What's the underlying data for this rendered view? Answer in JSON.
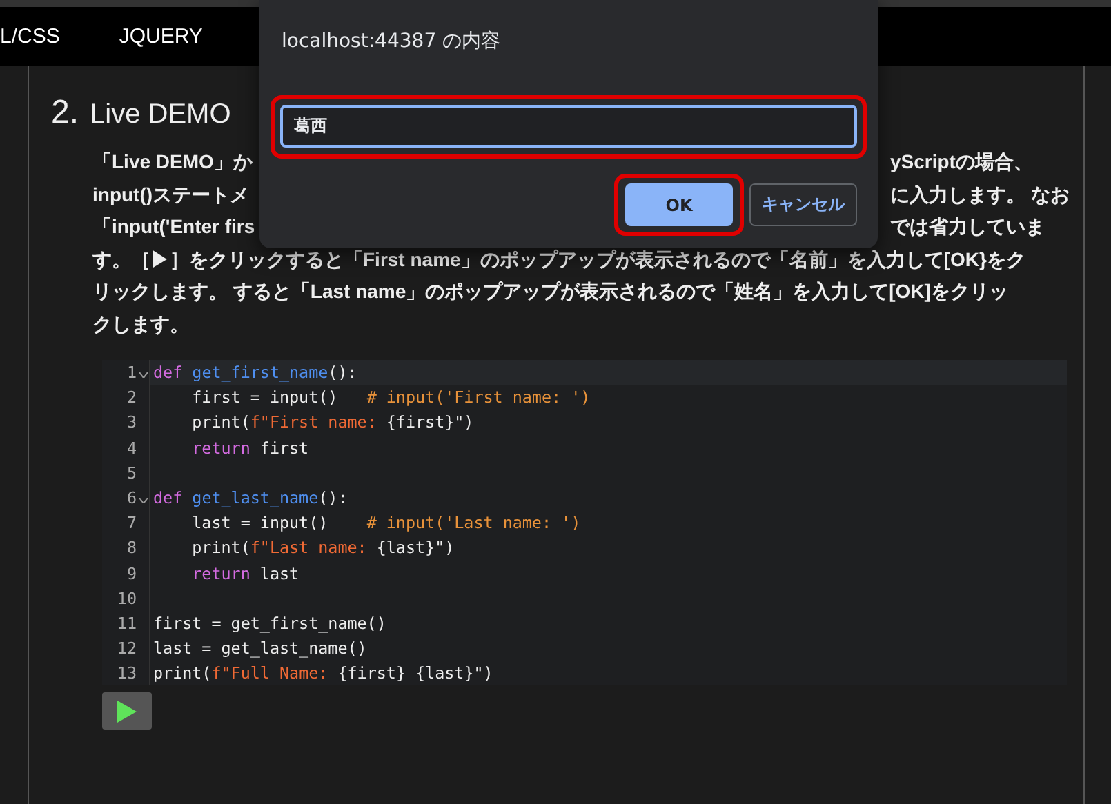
{
  "nav": {
    "items": [
      {
        "label": "L/CSS"
      },
      {
        "label": "JQUERY"
      }
    ]
  },
  "section": {
    "number": "2.",
    "title": "Live DEMO",
    "paragraph_lines": [
      {
        "left": "「Live DEMO」か",
        "right": "yScriptの場合、"
      },
      {
        "left": "input()ステートメ",
        "right": "に入力します。 なお"
      },
      {
        "left": "「input('Enter firs",
        "right": "では省力していま"
      },
      {
        "text": "す。［▶］をクリックすると「First name」のポップアップが表示されるので「名前」を入力して[OK}をク"
      },
      {
        "text": "リックします。 すると「Last name」のポップアップが表示されるので「姓名」を入力して[OK]をクリッ"
      },
      {
        "text": "クします。"
      }
    ]
  },
  "code": {
    "lines": [
      {
        "number": "1",
        "foldable": true,
        "active": true,
        "tokens": [
          {
            "text": "def ",
            "kind": "keyword"
          },
          {
            "text": "get_first_name",
            "kind": "function"
          },
          {
            "text": "():",
            "kind": "plain"
          }
        ]
      },
      {
        "number": "2",
        "foldable": false,
        "active": false,
        "tokens": [
          {
            "text": "    first = input()   ",
            "kind": "plain"
          },
          {
            "text": "# input('First name: ')",
            "kind": "comment"
          }
        ]
      },
      {
        "number": "3",
        "foldable": false,
        "active": false,
        "tokens": [
          {
            "text": "    print(",
            "kind": "plain"
          },
          {
            "text": "f\"First name: ",
            "kind": "string"
          },
          {
            "text": "{first}\")",
            "kind": "plain"
          }
        ]
      },
      {
        "number": "4",
        "foldable": false,
        "active": false,
        "tokens": [
          {
            "text": "    return",
            "kind": "keyword"
          },
          {
            "text": " first",
            "kind": "plain"
          }
        ]
      },
      {
        "number": "5",
        "foldable": false,
        "active": false
      },
      {
        "number": "6",
        "foldable": true,
        "active": false,
        "tokens": [
          {
            "text": "def ",
            "kind": "keyword"
          },
          {
            "text": "get_last_name",
            "kind": "function"
          },
          {
            "text": "():",
            "kind": "plain"
          }
        ]
      },
      {
        "number": "7",
        "foldable": false,
        "active": false,
        "tokens": [
          {
            "text": "    last = input()    ",
            "kind": "plain"
          },
          {
            "text": "# input('Last name: ')",
            "kind": "comment"
          }
        ]
      },
      {
        "number": "8",
        "foldable": false,
        "active": false,
        "tokens": [
          {
            "text": "    print(",
            "kind": "plain"
          },
          {
            "text": "f\"Last name: ",
            "kind": "string"
          },
          {
            "text": "{last}\")",
            "kind": "plain"
          }
        ]
      },
      {
        "number": "9",
        "foldable": false,
        "active": false,
        "tokens": [
          {
            "text": "    return",
            "kind": "keyword"
          },
          {
            "text": " last",
            "kind": "plain"
          }
        ]
      },
      {
        "number": "10",
        "foldable": false,
        "active": false
      },
      {
        "number": "11",
        "foldable": false,
        "active": false,
        "tokens": [
          {
            "text": "first = get_first_name()",
            "kind": "plain"
          }
        ]
      },
      {
        "number": "12",
        "foldable": false,
        "active": false,
        "tokens": [
          {
            "text": "last = get_last_name()",
            "kind": "plain"
          }
        ]
      },
      {
        "number": "13",
        "foldable": false,
        "active": false,
        "tokens": [
          {
            "text": "print(",
            "kind": "plain"
          },
          {
            "text": "f\"Full Name: ",
            "kind": "string"
          },
          {
            "text": "{first} {last}\")",
            "kind": "plain"
          }
        ]
      }
    ]
  },
  "dialog": {
    "title": "localhost:44387 の内容",
    "input": {
      "value": "葛西",
      "highlighted": true
    },
    "buttons": [
      {
        "label": "OK",
        "kind": "primary",
        "highlighted": true
      },
      {
        "label": "キャンセル",
        "kind": "secondary",
        "highlighted": false
      }
    ]
  }
}
